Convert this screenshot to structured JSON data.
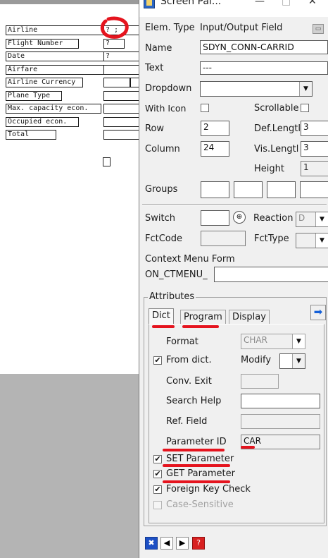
{
  "canvas": {
    "labels": [
      "Airline",
      "Flight Number",
      "Date",
      "Airfare",
      "Airline Currency",
      "Plane Type",
      "Max. capacity econ.",
      "Occupied econ.",
      "Total"
    ],
    "fields": [
      "? ;",
      "?",
      "?",
      "",
      "",
      "",
      "",
      "",
      ""
    ]
  },
  "window": {
    "title": "Screen Pai...",
    "minimize": "—",
    "maximize": "□",
    "close": "✕"
  },
  "props": {
    "elem_type_label": "Elem. Type",
    "elem_type_value": "Input/Output Field",
    "name_label": "Name",
    "name_value": "SDYN_CONN-CARRID",
    "text_label": "Text",
    "text_value": "---",
    "dropdown_label": "Dropdown",
    "dropdown_value": "",
    "with_icon_label": "With Icon",
    "scrollable_label": "Scrollable",
    "row_label": "Row",
    "row_value": "2",
    "def_length_label": "Def.Lengtl",
    "def_length_value": "3",
    "column_label": "Column",
    "column_value": "24",
    "vis_length_label": "Vis.Lengtl",
    "vis_length_value": "3",
    "height_label": "Height",
    "height_value": "1",
    "groups_label": "Groups"
  },
  "func": {
    "switch_label": "Switch",
    "reaction_label": "Reaction",
    "reaction_value": "D",
    "fctcode_label": "FctCode",
    "fcttype_label": "FctType",
    "context_menu_label": "Context Menu Form",
    "context_prefix": "ON_CTMENU_"
  },
  "attributes": {
    "group_title": "Attributes",
    "tabs": [
      "Dict",
      "Program",
      "Display"
    ],
    "format_label": "Format",
    "format_value": "CHAR",
    "from_dict_label": "From dict.",
    "modify_label": "Modify",
    "conv_exit_label": "Conv. Exit",
    "search_help_label": "Search Help",
    "ref_field_label": "Ref. Field",
    "parameter_id_label": "Parameter ID",
    "parameter_id_value": "CAR",
    "set_parameter_label": "SET Parameter",
    "get_parameter_label": "GET Parameter",
    "foreign_key_label": "Foreign Key Check",
    "case_sensitive_label": "Case-Sensitive"
  },
  "colors": {
    "annotation_red": "#e5141e",
    "dialog_bg": "#f0f0f0",
    "canvas_gray": "#b4b4b4"
  }
}
